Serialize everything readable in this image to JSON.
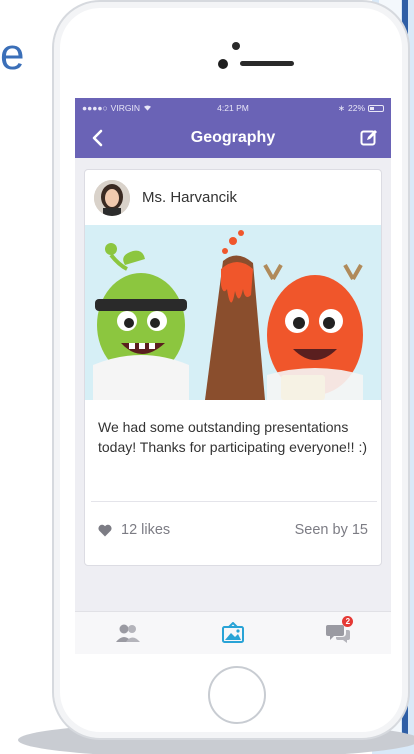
{
  "status_bar": {
    "carrier": "VIRGIN",
    "time": "4:21 PM",
    "battery": "22%"
  },
  "nav": {
    "title": "Geography"
  },
  "post": {
    "author": "Ms. Harvancik",
    "text": "We had some outstanding presentations today! Thanks for participating everyone!! :)",
    "likes": "12 likes",
    "seen": "Seen by 15"
  },
  "tabs": {
    "messages_badge": "2"
  },
  "background": {
    "partial_letter": "e"
  },
  "colors": {
    "nav": "#6a63b6",
    "active_tab": "#29a3d6",
    "badge": "#e53935"
  }
}
